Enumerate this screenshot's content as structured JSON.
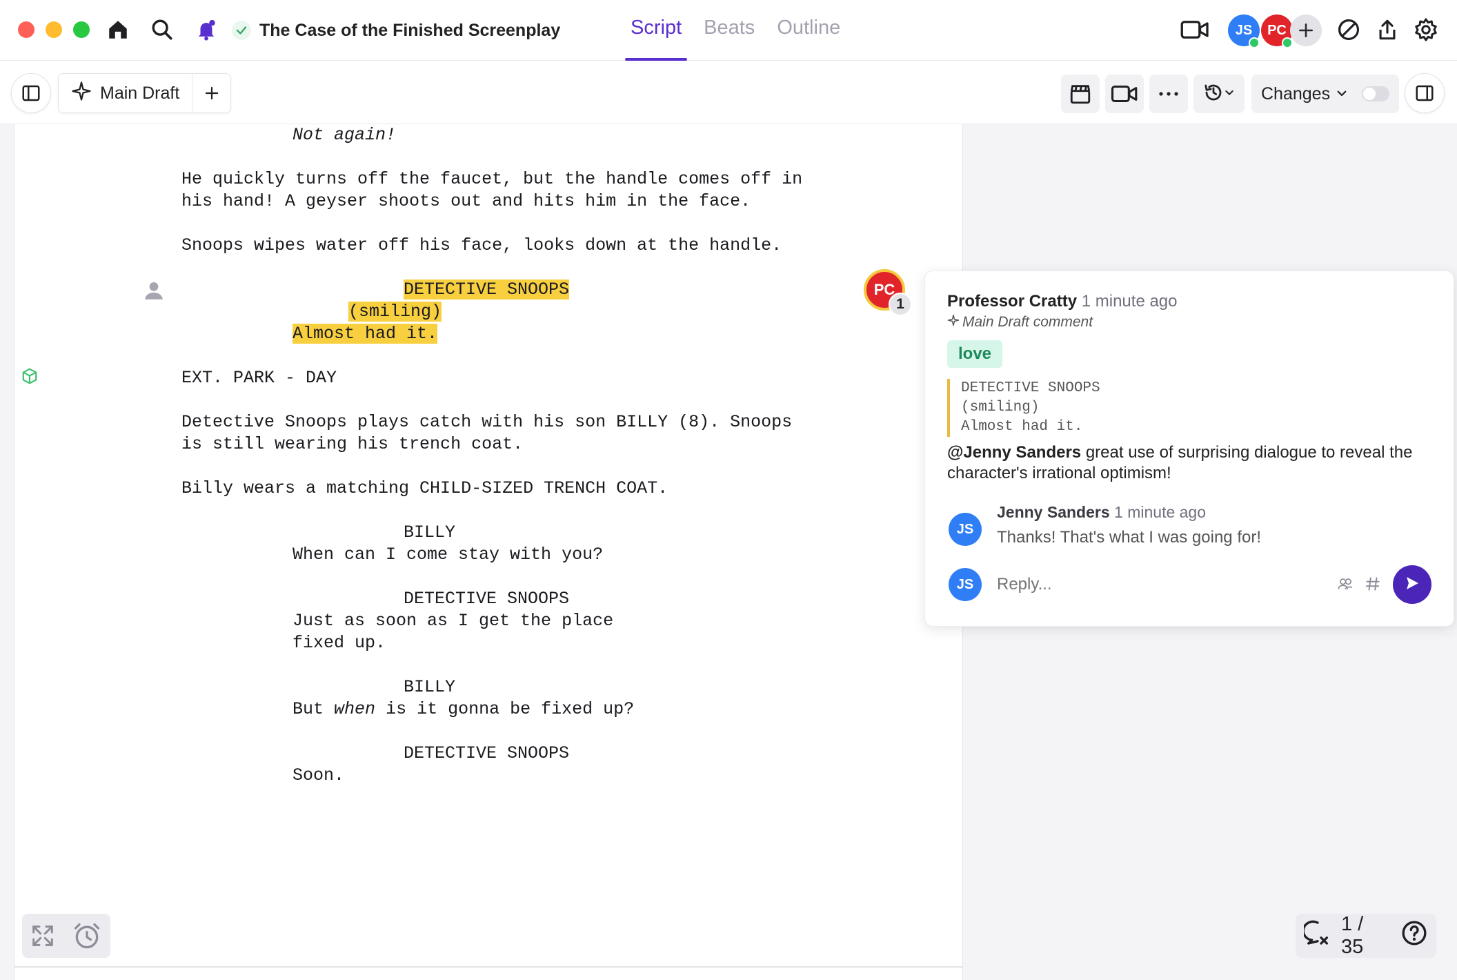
{
  "window": {
    "title": "The Case of the Finished Screenplay",
    "tabs": [
      {
        "label": "Script",
        "active": true
      },
      {
        "label": "Beats",
        "active": false
      },
      {
        "label": "Outline",
        "active": false
      }
    ],
    "collaborators": [
      {
        "initials": "JS",
        "color": "#2f7ef5",
        "online": true
      },
      {
        "initials": "PC",
        "color": "#e0242a",
        "online": true
      }
    ]
  },
  "toolbar": {
    "draft_label": "Main Draft",
    "changes_label": "Changes",
    "changes_enabled": false
  },
  "script": {
    "lines": [
      {
        "text": "Not again!",
        "style": "italic"
      },
      {
        "text": "He quickly turns off the faucet, but the handle comes off in"
      },
      {
        "text": "his hand! A geyser shoots out and hits him in the face."
      },
      {
        "text": "Snoops wipes water off his face, looks down at the handle."
      },
      {
        "text": "DETECTIVE SNOOPS",
        "highlight": true
      },
      {
        "text": "(smiling)",
        "highlight": true
      },
      {
        "text": "Almost had it.",
        "highlight": true
      },
      {
        "text": "EXT. PARK - DAY"
      },
      {
        "text": "Detective Snoops plays catch with his son BILLY (8). Snoops"
      },
      {
        "text": "is still wearing his trench coat."
      },
      {
        "text": "Billy wears a matching CHILD-SIZED TRENCH COAT."
      },
      {
        "text": "BILLY"
      },
      {
        "text": "When can I come stay with you?"
      },
      {
        "text": "DETECTIVE SNOOPS"
      },
      {
        "text": "Just as soon as I get the place"
      },
      {
        "text": "fixed up."
      },
      {
        "text": "BILLY"
      },
      {
        "text": "But",
        "after": "is it gonna be fixed up?",
        "emph": "when"
      },
      {
        "text": "DETECTIVE SNOOPS"
      },
      {
        "text": "Soon."
      }
    ]
  },
  "comment_marker": {
    "initials": "PC",
    "count": "1"
  },
  "comment": {
    "author": "Professor Cratty",
    "time": "1 minute ago",
    "context": "Main Draft comment",
    "tag": "love",
    "quote": [
      "DETECTIVE SNOOPS",
      "(smiling)",
      "Almost had it."
    ],
    "mention": "@Jenny Sanders",
    "body": "great use of surprising dialogue to reveal the character's irrational optimism!",
    "reply": {
      "initials": "JS",
      "author": "Jenny Sanders",
      "time": "1 minute ago",
      "text": "Thanks! That's what I was going for!"
    },
    "reply_input": {
      "initials": "JS",
      "placeholder": "Reply..."
    }
  },
  "pagination": {
    "label": "1 / 35"
  },
  "colors": {
    "accent": "#5a2fd0",
    "highlight": "#f7cf3f",
    "tag_bg": "#d7f6ea",
    "send": "#4a25b8"
  }
}
